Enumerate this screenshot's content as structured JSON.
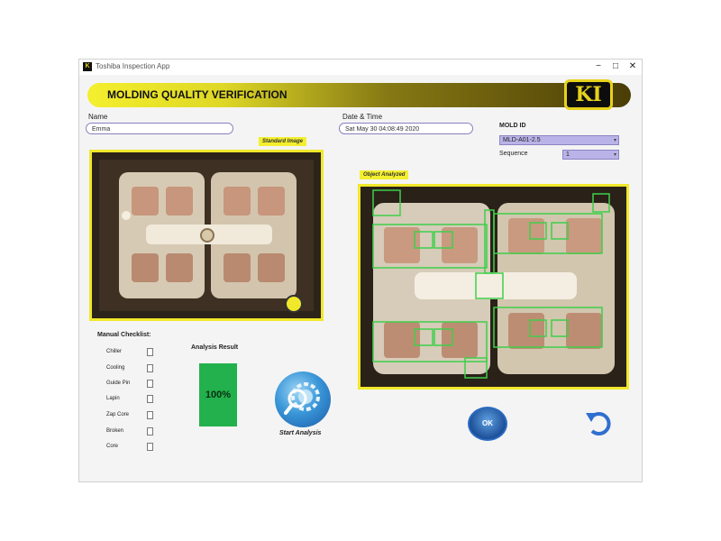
{
  "window": {
    "title": "Toshiba Inspection App",
    "minimize": "−",
    "restore": "□",
    "close": "✕"
  },
  "banner": {
    "title": "MOLDING QUALITY VERIFICATION",
    "logo_text": "KI"
  },
  "form": {
    "name_label": "Name",
    "name_value": "Emma",
    "datetime_label": "Date & Time",
    "datetime_value": "Sat May 30 04:08:49 2020",
    "mold_id_label": "MOLD ID",
    "mold_id_value": "MLD-A01-2.5",
    "sequence_label": "Sequence",
    "sequence_value": "1"
  },
  "images": {
    "standard_tag": "Standard Image",
    "object_tag": "Object Analyzed"
  },
  "manual_checklist": {
    "title": "Manual Checklist:",
    "items": [
      {
        "label": "Chiller",
        "checked": false
      },
      {
        "label": "Cooling",
        "checked": false
      },
      {
        "label": "Guide Pin",
        "checked": false
      },
      {
        "label": "Lapin",
        "checked": false
      },
      {
        "label": "Zap Core",
        "checked": false
      },
      {
        "label": "Broken",
        "checked": false
      },
      {
        "label": "Core",
        "checked": false
      }
    ]
  },
  "analysis": {
    "title": "Analysis Result",
    "value": "100%",
    "percent": 100,
    "color": "#22b14c"
  },
  "buttons": {
    "start_label": "Start Analysis",
    "ok_label": "OK"
  },
  "colors": {
    "accent_yellow": "#f1e82b",
    "detection_box": "#3ecf4a",
    "select_bg": "#b9b3e8"
  }
}
